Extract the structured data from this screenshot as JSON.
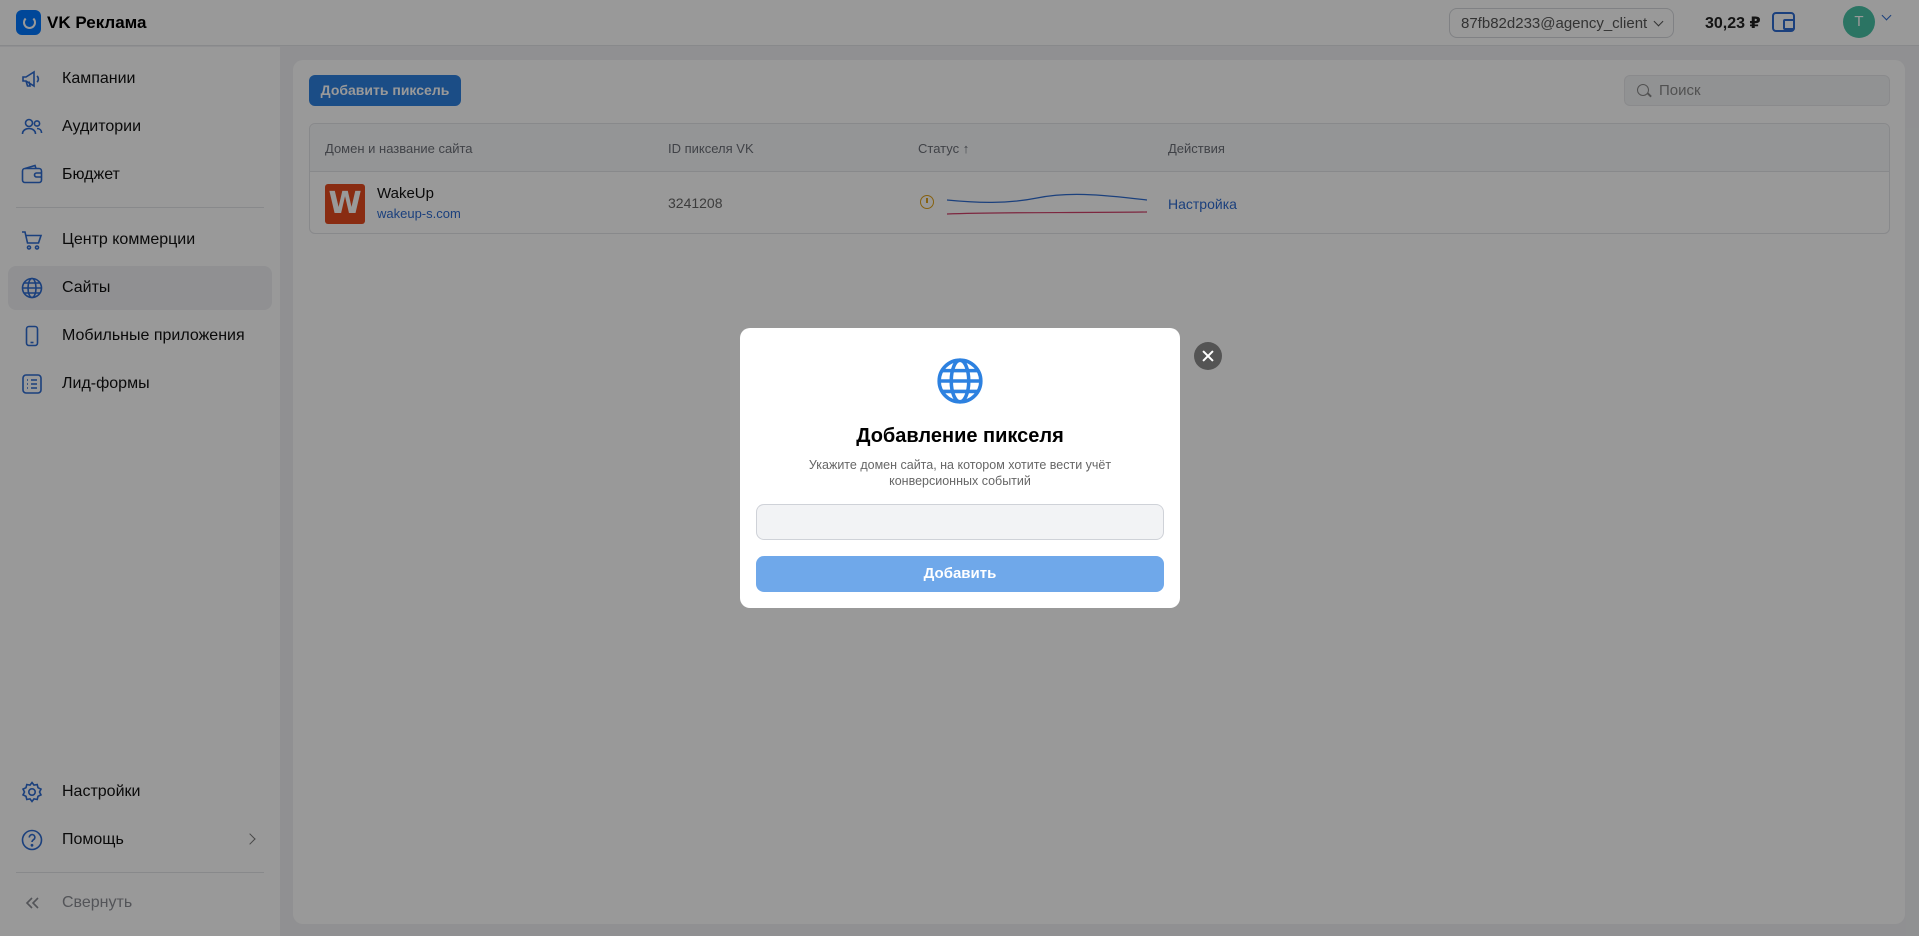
{
  "app": {
    "logo_text": "VK Реклама",
    "account": "87fb82d233@agency_client",
    "balance": "30,23 ₽",
    "avatar_letter": "T"
  },
  "sidebar": {
    "items": [
      {
        "label": "Кампании",
        "icon": "megaphone-icon"
      },
      {
        "label": "Аудитории",
        "icon": "users-icon"
      },
      {
        "label": "Бюджет",
        "icon": "wallet-icon"
      },
      {
        "label": "Центр коммерции",
        "icon": "cart-icon"
      },
      {
        "label": "Сайты",
        "icon": "globe-icon",
        "active": true
      },
      {
        "label": "Мобильные приложения",
        "icon": "phone-icon"
      },
      {
        "label": "Лид-формы",
        "icon": "list-icon"
      }
    ],
    "bottom": {
      "settings": "Настройки",
      "help": "Помощь",
      "collapse": "Свернуть"
    }
  },
  "main": {
    "add_button": "Добавить пиксель",
    "search_placeholder": "Поиск",
    "table": {
      "headers": [
        "Домен и название сайта",
        "ID пикселя VK",
        "Статус ↑",
        "Действия"
      ],
      "rows": [
        {
          "logo_letter": "W",
          "name": "WakeUp",
          "domain": "wakeup-s.com",
          "pixel_id": "3241208",
          "status": "warning",
          "action": "Настройка"
        }
      ]
    }
  },
  "modal": {
    "icon": "globe-icon",
    "title": "Добавление пикселя",
    "subtitle": "Укажите домен сайта, на котором хотите вести учёт конверсионных событий",
    "input_value": "",
    "input_placeholder": "",
    "submit": "Добавить"
  },
  "colors": {
    "accent": "#2d81e0",
    "accent_disabled": "#6fa8ea",
    "warning": "#e0a21a",
    "brand_logo": "#e44a1f"
  }
}
